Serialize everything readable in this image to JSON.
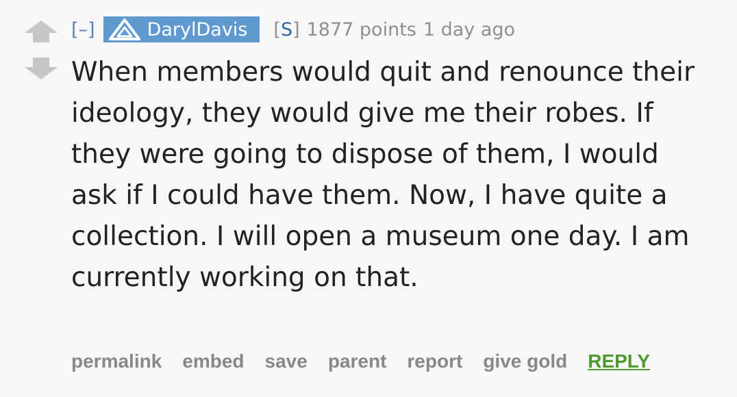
{
  "vote": {
    "up_icon": "upvote-arrow-icon",
    "down_icon": "downvote-arrow-icon",
    "arrow_color": "#c6c6c6"
  },
  "comment": {
    "expand_label": "[–]",
    "admin_icon": "admin-shield-icon",
    "author": "DarylDavis",
    "author_bg": "#5f99cf",
    "submitter_open": "[",
    "submitter_tag": "S",
    "submitter_close": "]",
    "score": "1877 points",
    "time": "1 day ago",
    "body": "When members would quit and renounce their ideology, they would give me their robes. If they were going to dispose of them, I would ask if I could have them. Now, I have quite a collection. I will open a museum one day. I am currently working on that."
  },
  "actions": {
    "permalink": "permalink",
    "embed": "embed",
    "save": "save",
    "parent": "parent",
    "report": "report",
    "give_gold": "give gold",
    "reply": "REPLY",
    "reply_color": "#4f9a2f"
  }
}
